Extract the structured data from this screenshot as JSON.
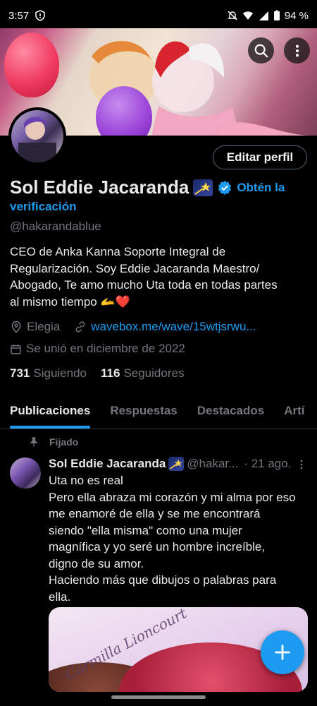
{
  "status_bar": {
    "time": "3:57",
    "battery": "94 %"
  },
  "profile": {
    "display_name": "Sol Eddie Jacaranda",
    "verify_prompt_1": "Obtén la",
    "verify_prompt_2": "verificación",
    "handle": "@hakarandablue",
    "bio": "CEO de Anka Kanna Soporte Integral de\nRegularización. Soy Eddie Jacaranda  Maestro/\nAbogado,  Te amo mucho Uta toda en todas partes\nal mismo tiempo ",
    "bio_emojis": "🫴❤️",
    "location": "Elegia",
    "website": "wavebox.me/wave/15wtjsrwu...",
    "joined": "Se unió en diciembre de 2022",
    "following_count": "731",
    "following_label": "Siguiendo",
    "followers_count": "116",
    "followers_label": "Seguidores",
    "edit_button": "Editar perfil"
  },
  "tabs": [
    {
      "label": "Publicaciones",
      "active": true
    },
    {
      "label": "Respuestas",
      "active": false
    },
    {
      "label": "Destacados",
      "active": false
    },
    {
      "label": "Artí",
      "active": false
    }
  ],
  "pinned_post": {
    "pinned_label": "Fijado",
    "author_name": "Sol Eddie Jacaranda",
    "author_handle": "@hakar...",
    "date": "· 21 ago.",
    "text": "Uta no es real\nPero ella abraza mi corazón y mi alma por eso\nme enamoré de ella y se me encontrará\nsiendo \"ella misma\" como una mujer\nmagnífica y yo seré un hombre increíble,\ndigno de su amor.\nHaciendo más que dibujos o palabras para\nella.",
    "media_watermark": "Carmilla Lioncourt"
  },
  "icons": {
    "search": "search-icon",
    "more": "more-vertical-icon",
    "verified": "verified-badge-icon",
    "location": "location-pin-icon",
    "link": "link-icon",
    "calendar": "calendar-icon",
    "pin": "pin-icon",
    "compose": "plus-icon"
  },
  "colors": {
    "accent": "#1d9bf0",
    "background": "#000000",
    "text_primary": "#e7e9ea",
    "text_secondary": "#71767b"
  }
}
